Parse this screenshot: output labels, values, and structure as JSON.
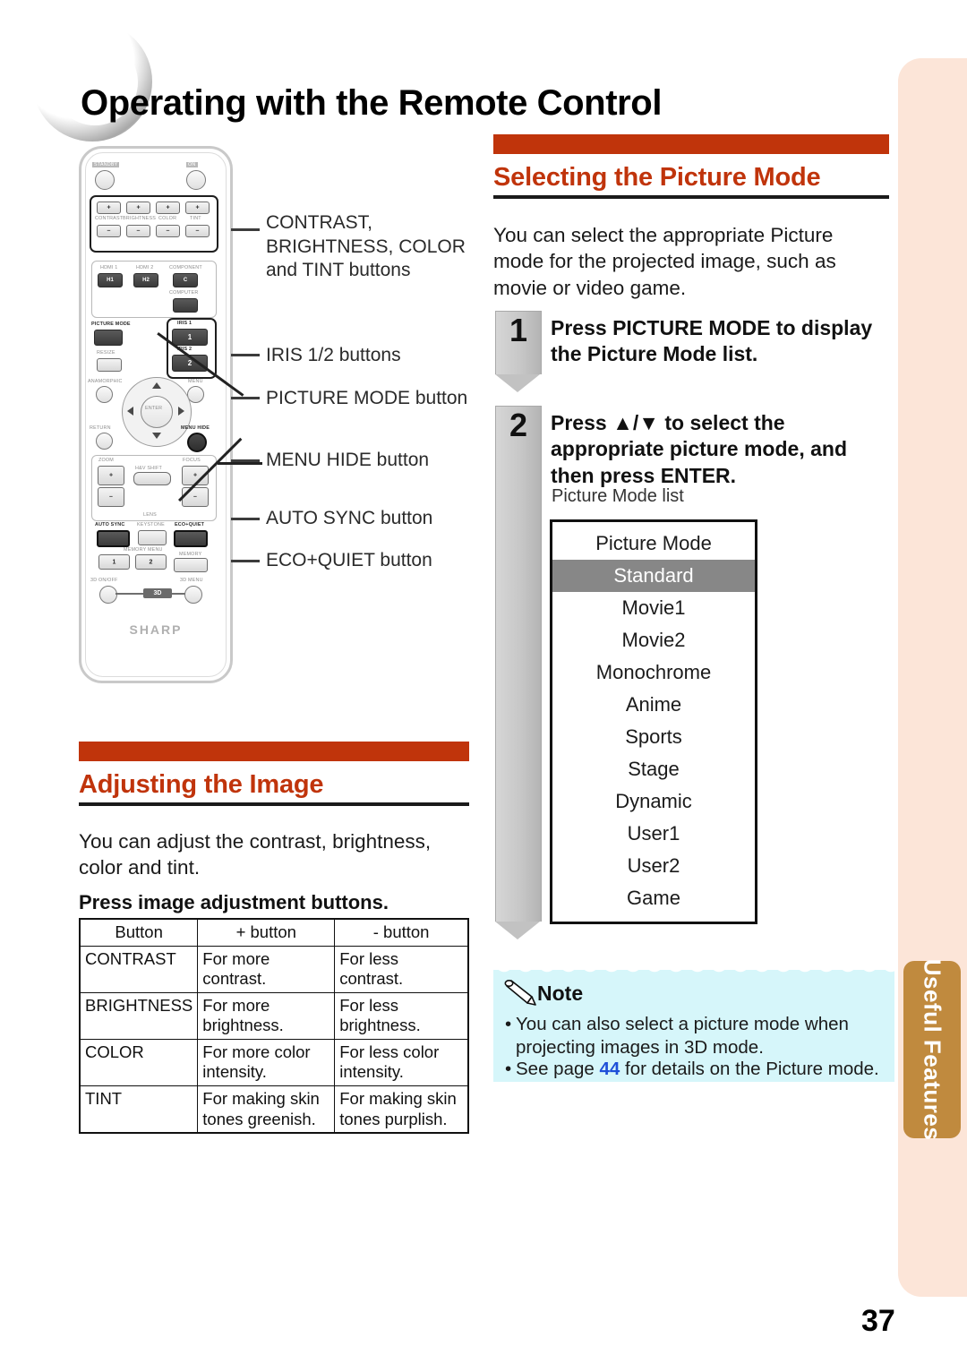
{
  "page": {
    "title": "Operating with the Remote Control",
    "number": "37",
    "side_tab": "Useful\nFeatures",
    "accent_color": "#c0340b",
    "band_color": "#fce5d8",
    "tab_color": "#c08a3e"
  },
  "remote": {
    "labels": {
      "standby": "STANDBY",
      "on": "ON",
      "contrast": "CONTRAST",
      "brightness": "BRIGHTNESS",
      "color": "COLOR",
      "tint": "TINT",
      "hdmi1": "HDMI 1",
      "hdmi2": "HDMI 2",
      "component": "COMPONENT",
      "computer": "COMPUTER",
      "picture_mode": "PICTURE MODE",
      "iris1": "IRIS 1",
      "iris2": "IRIS 2",
      "resize": "RESIZE",
      "anamorphic": "ANAMORPHIC",
      "menu": "MENU",
      "return": "RETURN",
      "enter": "ENTER",
      "menu_hide": "MENU HIDE",
      "zoom": "ZOOM",
      "hv_shift": "H&V SHIFT",
      "focus": "FOCUS",
      "lens": "LENS",
      "auto_sync": "AUTO SYNC",
      "keystone": "KEYSTONE",
      "eco_quiet": "ECO+QUIET",
      "memory_menu": "MEMORY MENU",
      "memory": "MEMORY",
      "mem1": "1",
      "mem2": "2",
      "three_d_onoff": "3D ON/OFF",
      "three_d": "3D",
      "three_d_menu": "3D MENU",
      "brand": "SHARP",
      "h1": "H1",
      "h2": "H2",
      "c": "C",
      "iris1_num": "1",
      "iris2_num": "2",
      "plus": "+",
      "minus": "–"
    }
  },
  "callouts": [
    {
      "id": "contrast-group",
      "text": "CONTRAST,\nBRIGHTNESS, COLOR\nand TINT buttons"
    },
    {
      "id": "iris",
      "text": "IRIS 1/2 buttons"
    },
    {
      "id": "picture-mode",
      "text": "PICTURE MODE button"
    },
    {
      "id": "menu-hide",
      "text": "MENU HIDE button"
    },
    {
      "id": "auto-sync",
      "text": "AUTO SYNC button"
    },
    {
      "id": "eco-quiet",
      "text": "ECO+QUIET button"
    }
  ],
  "picture_mode_section": {
    "heading": "Selecting the Picture Mode",
    "intro": "You can select the appropriate Picture mode for the projected image, such as movie or video game.",
    "steps": [
      {
        "number": "1",
        "text_parts": [
          {
            "t": "Press ",
            "bold": false
          },
          {
            "t": "PICTURE MODE",
            "bold": true
          },
          {
            "t": " to display the Picture Mode list.",
            "bold": false
          }
        ],
        "plain": "Press PICTURE MODE to display the Picture Mode list."
      },
      {
        "number": "2",
        "text_parts": [
          {
            "t": "Press ",
            "bold": false
          },
          {
            "t": "▲/▼",
            "bold": true
          },
          {
            "t": " to select the appropriate picture mode, and then press ",
            "bold": false
          },
          {
            "t": "ENTER",
            "bold": true
          },
          {
            "t": ".",
            "bold": false
          }
        ],
        "plain": "Press ▲/▼ to select the appropriate picture mode, and then press ENTER."
      }
    ],
    "list_caption": "Picture Mode list",
    "list_header": "Picture Mode",
    "list_items": [
      {
        "label": "Standard",
        "selected": true
      },
      {
        "label": "Movie1",
        "selected": false
      },
      {
        "label": "Movie2",
        "selected": false
      },
      {
        "label": "Monochrome",
        "selected": false
      },
      {
        "label": "Anime",
        "selected": false
      },
      {
        "label": "Sports",
        "selected": false
      },
      {
        "label": "Stage",
        "selected": false
      },
      {
        "label": "Dynamic",
        "selected": false
      },
      {
        "label": "User1",
        "selected": false
      },
      {
        "label": "User2",
        "selected": false
      },
      {
        "label": "Game",
        "selected": false
      }
    ]
  },
  "note": {
    "title": "Note",
    "items": [
      {
        "pre": "You can also select a picture mode when projecting images in 3D mode.",
        "ref": "",
        "post": ""
      },
      {
        "pre": "See page ",
        "ref": "44",
        "post": " for details on the Picture mode."
      }
    ]
  },
  "adjust_section": {
    "heading": "Adjusting the Image",
    "intro": "You can adjust the contrast, brightness, color and tint.",
    "subheading": "Press image adjustment buttons.",
    "table": {
      "headers": [
        "Button",
        "+ button",
        "- button"
      ],
      "rows": [
        [
          "CONTRAST",
          "For more contrast.",
          "For less contrast."
        ],
        [
          "BRIGHTNESS",
          "For more brightness.",
          "For less brightness."
        ],
        [
          "COLOR",
          "For more color intensity.",
          "For less color intensity."
        ],
        [
          "TINT",
          "For making skin tones greenish.",
          "For making skin tones purplish."
        ]
      ]
    }
  }
}
